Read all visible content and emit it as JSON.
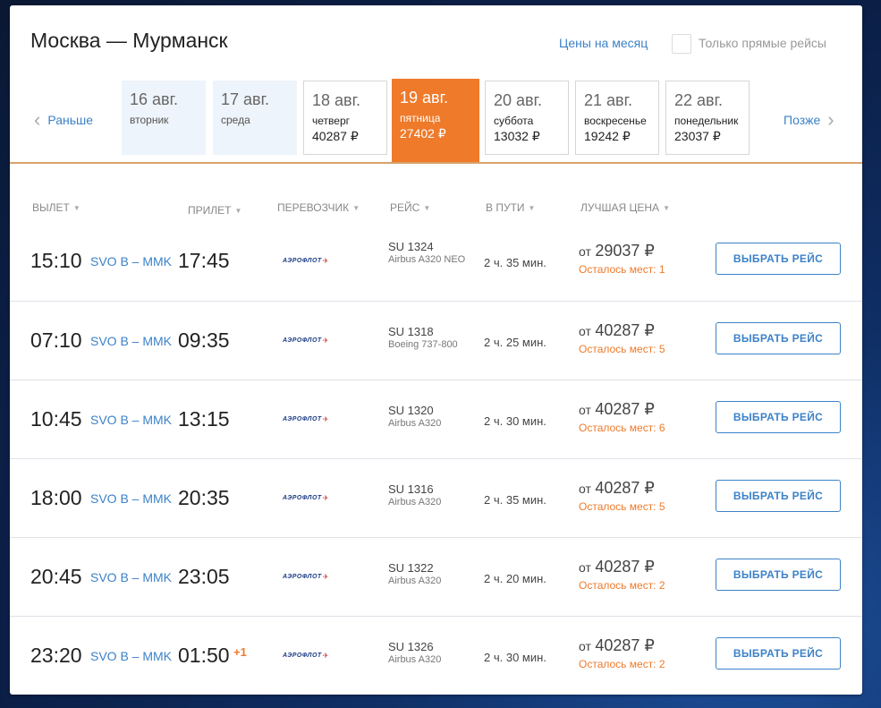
{
  "header": {
    "title": "Москва — Мурманск",
    "month_prices_link": "Цены на месяц",
    "direct_only_label": "Только прямые рейсы"
  },
  "date_nav": {
    "prev_label": "Раньше",
    "next_label": "Позже",
    "dates": [
      {
        "day": "16 авг.",
        "weekday": "вторник",
        "price": ""
      },
      {
        "day": "17 авг.",
        "weekday": "среда",
        "price": ""
      },
      {
        "day": "18 авг.",
        "weekday": "четверг",
        "price": "40287 ₽"
      },
      {
        "day": "19 авг.",
        "weekday": "пятница",
        "price": "27402 ₽"
      },
      {
        "day": "20 авг.",
        "weekday": "суббота",
        "price": "13032 ₽"
      },
      {
        "day": "21 авг.",
        "weekday": "воскресенье",
        "price": "19242 ₽"
      },
      {
        "day": "22 авг.",
        "weekday": "понедельник",
        "price": "23037 ₽"
      }
    ]
  },
  "columns": {
    "departure": "ВЫЛЕТ",
    "arrival": "ПРИЛЕТ",
    "carrier": "ПЕРЕВОЗЧИК",
    "flight": "РЕЙС",
    "duration": "В ПУТИ",
    "best_price": "ЛУЧШАЯ ЦЕНА"
  },
  "carrier_logo_text": "АЭРОФЛОТ",
  "price_prefix": "от",
  "select_button_label": "ВЫБРАТЬ РЕЙС",
  "colors": {
    "accent": "#3c82c8",
    "orange": "#ee7a2a"
  },
  "flights": [
    {
      "dep": "15:10",
      "route": "SVO B – MMK",
      "arr": "17:45",
      "next_day": "",
      "flight_no": "SU 1324",
      "aircraft": "Airbus A320 NEO",
      "duration": "2 ч. 35 мин.",
      "price": "29037 ₽",
      "seats": "Осталось мест: 1"
    },
    {
      "dep": "07:10",
      "route": "SVO B – MMK",
      "arr": "09:35",
      "next_day": "",
      "flight_no": "SU 1318",
      "aircraft": "Boeing 737-800",
      "duration": "2 ч. 25 мин.",
      "price": "40287 ₽",
      "seats": "Осталось мест: 5"
    },
    {
      "dep": "10:45",
      "route": "SVO B – MMK",
      "arr": "13:15",
      "next_day": "",
      "flight_no": "SU 1320",
      "aircraft": "Airbus A320",
      "duration": "2 ч. 30 мин.",
      "price": "40287 ₽",
      "seats": "Осталось мест: 6"
    },
    {
      "dep": "18:00",
      "route": "SVO B – MMK",
      "arr": "20:35",
      "next_day": "",
      "flight_no": "SU 1316",
      "aircraft": "Airbus A320",
      "duration": "2 ч. 35 мин.",
      "price": "40287 ₽",
      "seats": "Осталось мест: 5"
    },
    {
      "dep": "20:45",
      "route": "SVO B – MMK",
      "arr": "23:05",
      "next_day": "",
      "flight_no": "SU 1322",
      "aircraft": "Airbus A320",
      "duration": "2 ч. 20 мин.",
      "price": "40287 ₽",
      "seats": "Осталось мест: 2"
    },
    {
      "dep": "23:20",
      "route": "SVO B – MMK",
      "arr": "01:50",
      "next_day": "+1",
      "flight_no": "SU 1326",
      "aircraft": "Airbus A320",
      "duration": "2 ч. 30 мин.",
      "price": "40287 ₽",
      "seats": "Осталось мест: 2"
    }
  ]
}
